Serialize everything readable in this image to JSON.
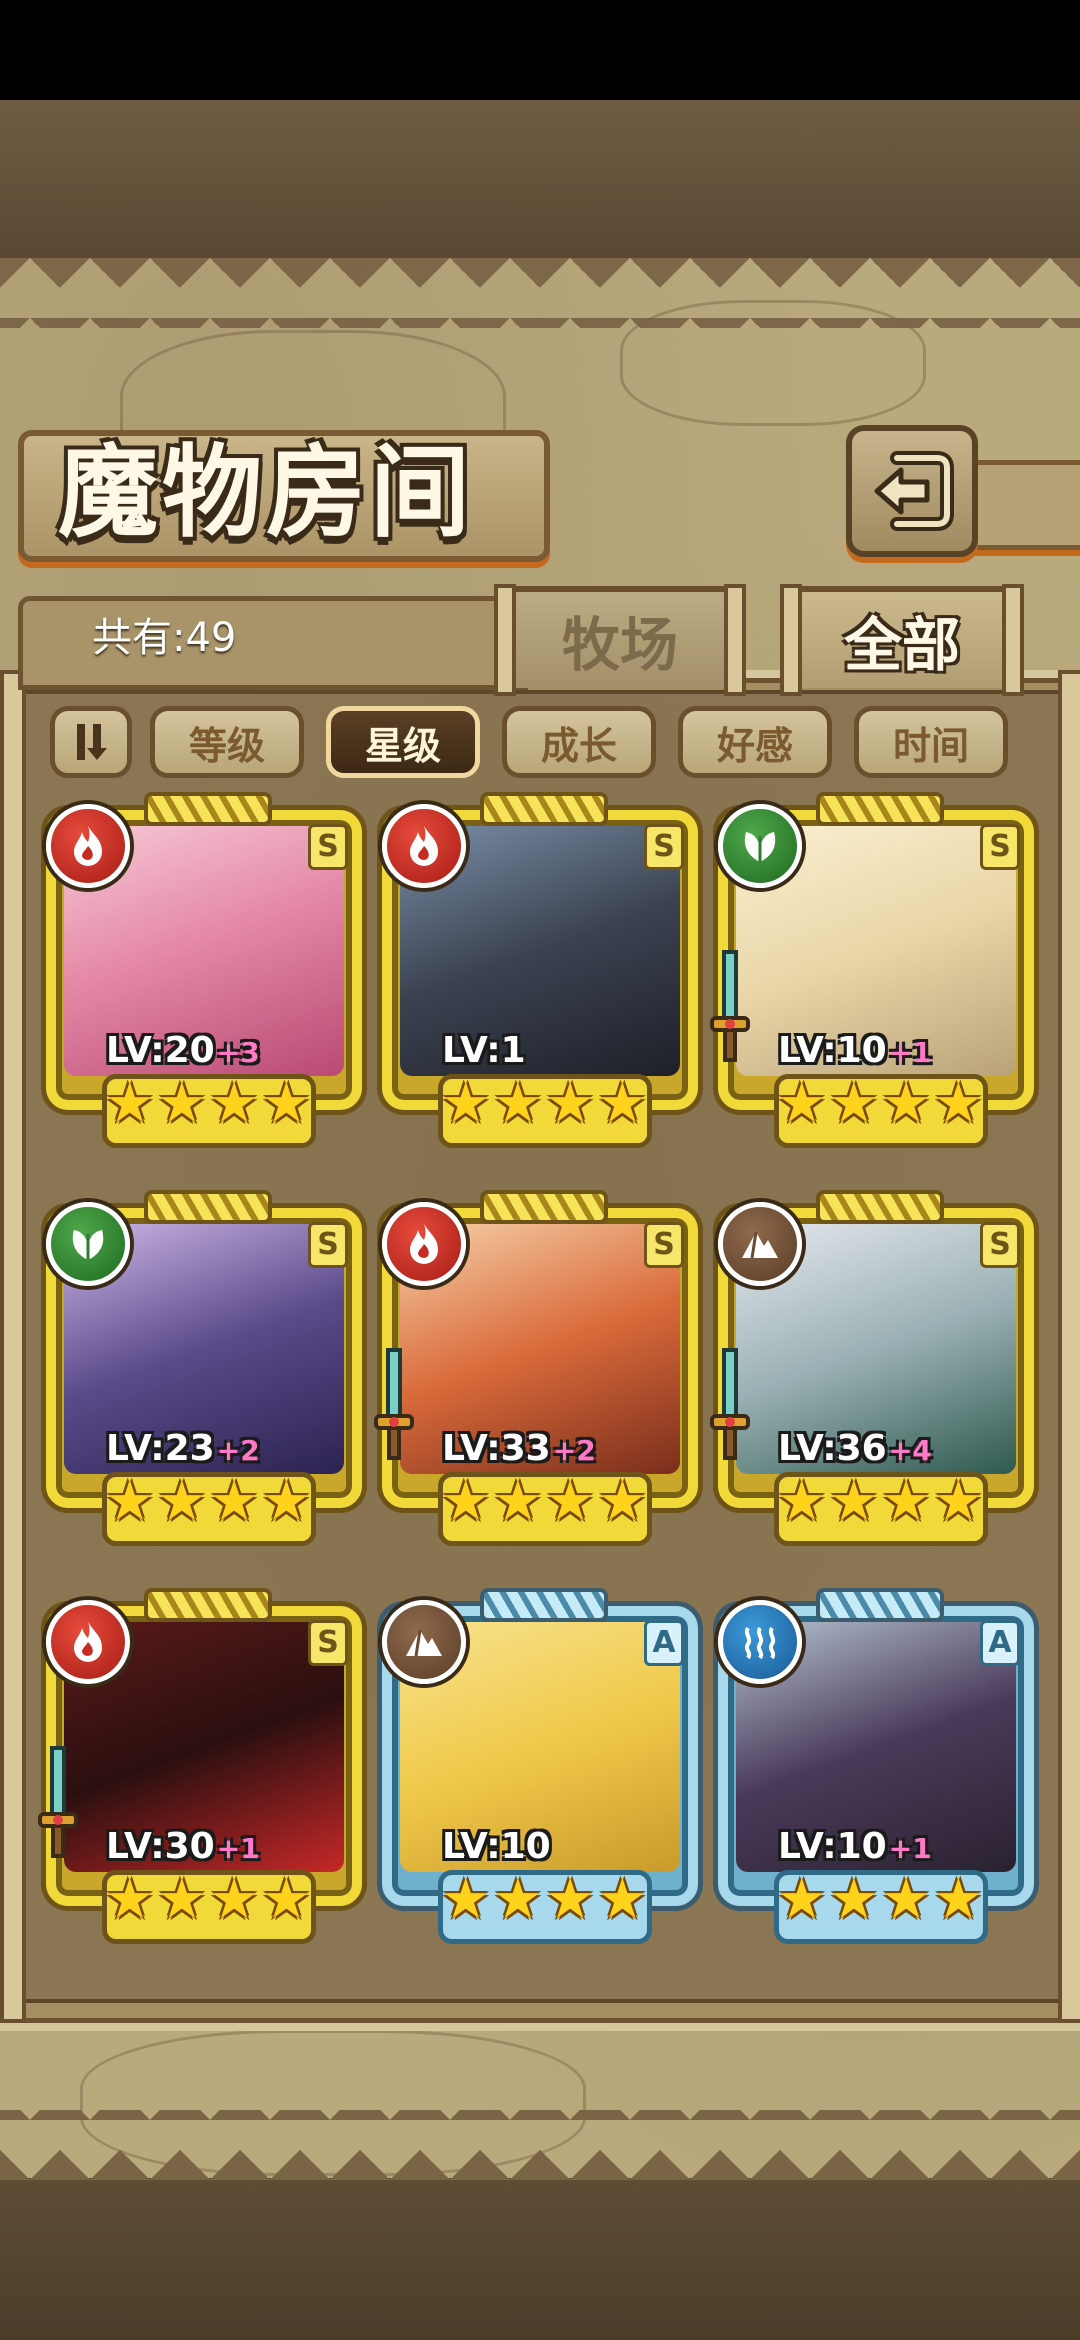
{
  "header": {
    "title": "魔物房间"
  },
  "summary": {
    "count_label": "共有:49"
  },
  "tabs": [
    {
      "label": "牧场",
      "active": false
    },
    {
      "label": "全部",
      "active": true
    }
  ],
  "sort": {
    "options": [
      "等级",
      "星级",
      "成长",
      "好感",
      "时间"
    ],
    "selected": "星级"
  },
  "monsters": [
    {
      "element": "fire",
      "rank": "S",
      "level": "LV:20",
      "plus": "+3",
      "stars": 4,
      "weapon": false
    },
    {
      "element": "fire",
      "rank": "S",
      "level": "LV:1",
      "plus": "",
      "stars": 4,
      "weapon": false
    },
    {
      "element": "leaf",
      "rank": "S",
      "level": "LV:10",
      "plus": "+1",
      "stars": 4,
      "weapon": true
    },
    {
      "element": "leaf",
      "rank": "S",
      "level": "LV:23",
      "plus": "+2",
      "stars": 4,
      "weapon": false
    },
    {
      "element": "fire",
      "rank": "S",
      "level": "LV:33",
      "plus": "+2",
      "stars": 4,
      "weapon": true
    },
    {
      "element": "earth",
      "rank": "S",
      "level": "LV:36",
      "plus": "+4",
      "stars": 4,
      "weapon": true
    },
    {
      "element": "fire",
      "rank": "S",
      "level": "LV:30",
      "plus": "+1",
      "stars": 4,
      "weapon": true
    },
    {
      "element": "earth",
      "rank": "A",
      "level": "LV:10",
      "plus": "",
      "stars": 4,
      "weapon": false
    },
    {
      "element": "water",
      "rank": "A",
      "level": "LV:10",
      "plus": "+1",
      "stars": 4,
      "weapon": false
    }
  ],
  "colors": {
    "fire": "#c62a20",
    "leaf": "#2e7d32",
    "earth": "#6b4a32",
    "water": "#2a7cc0",
    "frame_s": "#f2d93a",
    "frame_a": "#a7d8ec"
  }
}
